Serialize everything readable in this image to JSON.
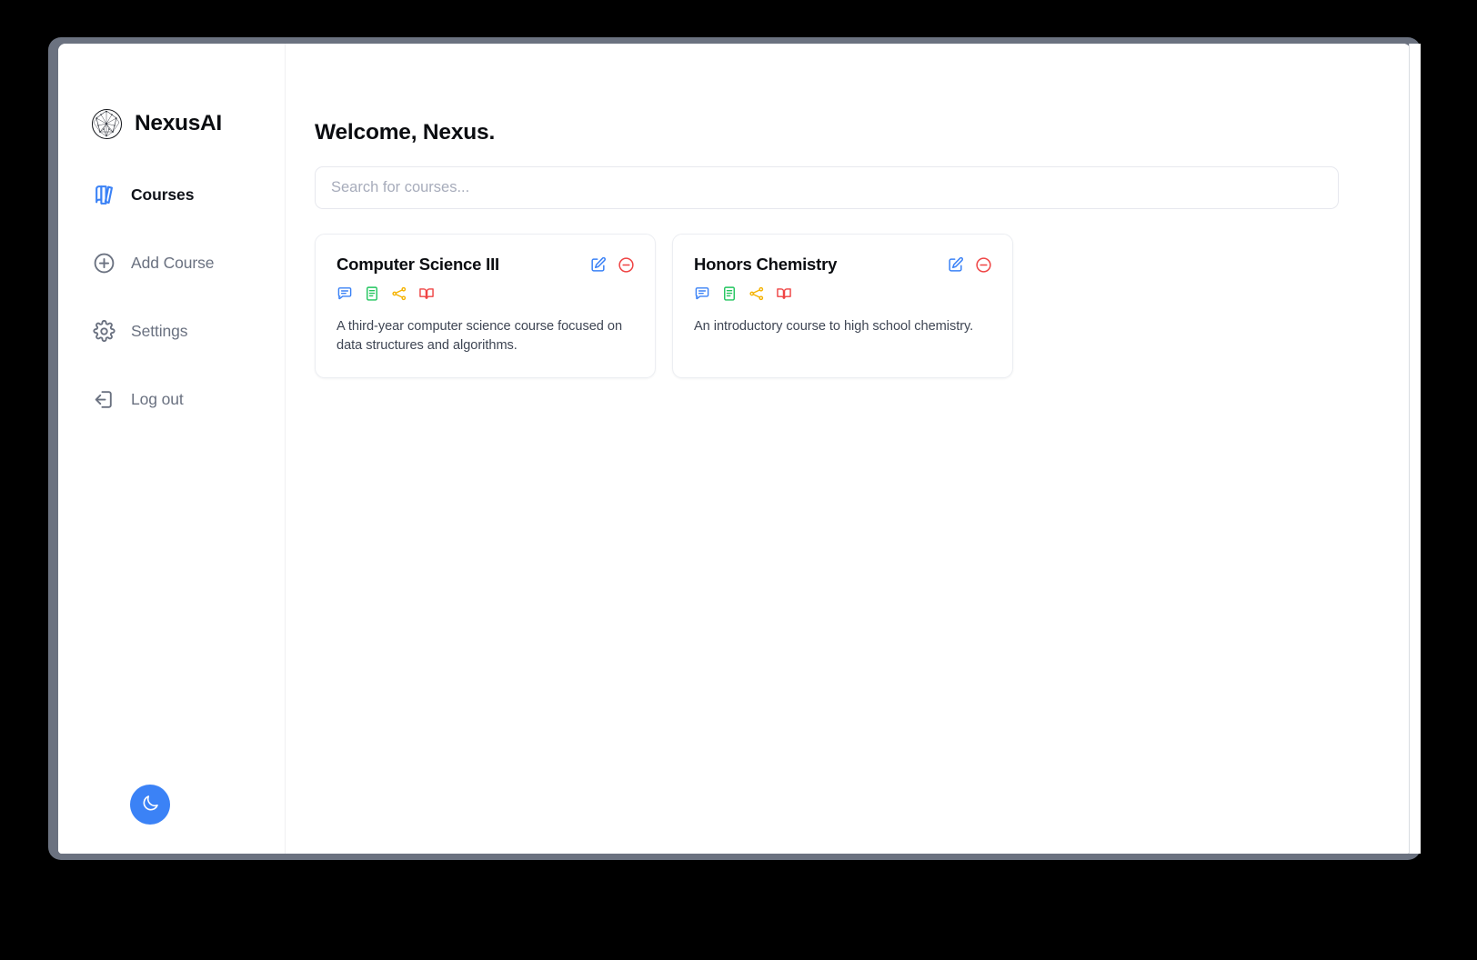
{
  "app": {
    "brand_name": "NexusAI",
    "logo_icon": "network-globe-icon"
  },
  "sidebar": {
    "items": [
      {
        "label": "Courses",
        "icon": "library-books-icon",
        "active": true
      },
      {
        "label": "Add Course",
        "icon": "plus-circle-icon",
        "active": false
      },
      {
        "label": "Settings",
        "icon": "gear-icon",
        "active": false
      },
      {
        "label": "Log out",
        "icon": "logout-icon",
        "active": false
      }
    ],
    "theme_toggle": {
      "icon": "moon-icon",
      "color": "#3b82f6"
    }
  },
  "main": {
    "page_title": "Welcome, Nexus.",
    "search": {
      "placeholder": "Search for courses...",
      "value": ""
    },
    "courses": [
      {
        "title": "Computer Science III",
        "description": "A third-year computer science course focused on data structures and algorithms.",
        "edit_icon": "edit-pencil-square-icon",
        "delete_icon": "minus-circle-icon",
        "feature_icons": [
          {
            "name": "chat-bubble-icon",
            "color": "#3b82f6"
          },
          {
            "name": "notes-document-icon",
            "color": "#22c55e"
          },
          {
            "name": "flowchart-network-icon",
            "color": "#f5b301"
          },
          {
            "name": "open-book-icon",
            "color": "#ef4444"
          }
        ]
      },
      {
        "title": "Honors Chemistry",
        "description": "An introductory course to high school chemistry.",
        "edit_icon": "edit-pencil-square-icon",
        "delete_icon": "minus-circle-icon",
        "feature_icons": [
          {
            "name": "chat-bubble-icon",
            "color": "#3b82f6"
          },
          {
            "name": "notes-document-icon",
            "color": "#22c55e"
          },
          {
            "name": "flowchart-network-icon",
            "color": "#f5b301"
          },
          {
            "name": "open-book-icon",
            "color": "#ef4444"
          }
        ]
      }
    ]
  },
  "colors": {
    "accent": "#3b82f6",
    "danger": "#ef4444",
    "frame": "#6b7280",
    "text_muted": "#6a7180"
  }
}
